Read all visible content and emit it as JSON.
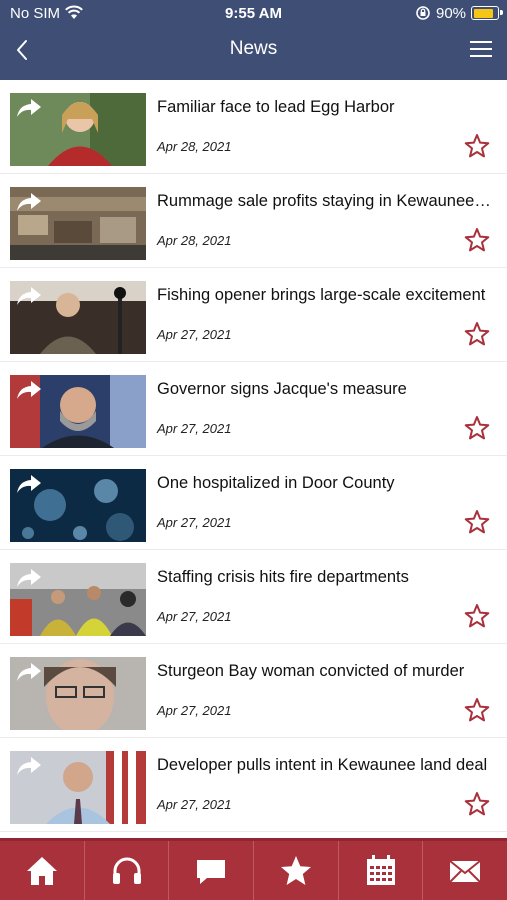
{
  "status_bar": {
    "carrier": "No SIM",
    "time": "9:55 AM",
    "battery_percent": "90%",
    "battery_level": 0.9,
    "battery_color": "#f5c518"
  },
  "header": {
    "title": "News",
    "back_icon": "chevron-left-icon",
    "menu_icon": "hamburger-menu-icon",
    "background": "#3f4e75"
  },
  "articles": [
    {
      "headline": "Familiar face to lead Egg Harbor",
      "date": "Apr 28, 2021"
    },
    {
      "headline": "Rummage sale profits staying in Kewaunee County",
      "date": "Apr 28, 2021"
    },
    {
      "headline": "Fishing opener brings large-scale excitement",
      "date": "Apr 27, 2021"
    },
    {
      "headline": "Governor signs Jacque's measure",
      "date": "Apr 27, 2021"
    },
    {
      "headline": "One hospitalized in Door County",
      "date": "Apr 27, 2021"
    },
    {
      "headline": "Staffing crisis hits fire departments",
      "date": "Apr 27, 2021"
    },
    {
      "headline": "Sturgeon Bay woman convicted of murder",
      "date": "Apr 27, 2021"
    },
    {
      "headline": "Developer pulls intent in Kewaunee land deal",
      "date": "Apr 27, 2021"
    }
  ],
  "tab_bar": {
    "background": "#a8313b",
    "tabs": [
      "home-icon",
      "headphones-icon",
      "chat-bubble-icon",
      "star-icon",
      "calendar-icon",
      "mail-icon"
    ]
  },
  "accent_color": "#a8313b"
}
